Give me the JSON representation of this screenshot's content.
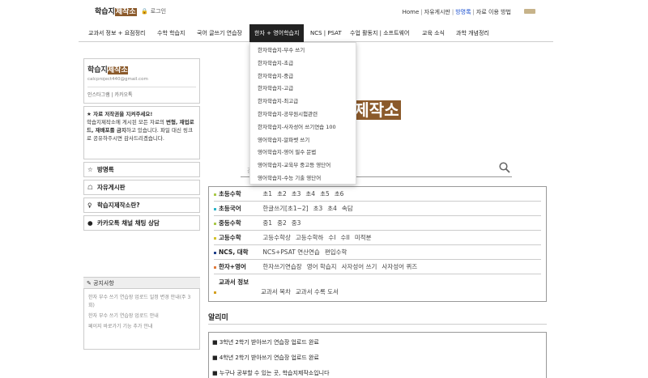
{
  "header": {
    "logo_text": "학습지",
    "logo_highlight": "제작소",
    "login_label": "로그인",
    "links": [
      "Home",
      "자유게시판",
      "방명록",
      "자료 이용 방법"
    ]
  },
  "nav": {
    "items": [
      "교과서 정보 + 요점정리",
      "수학 학습지",
      "국어 글쓰기 연습장",
      "한자 + 영어학습지",
      "NCS | PSAT",
      "수업 활동지 | 소프트웨어",
      "교육 소식",
      "과학 개념정리"
    ],
    "active": "한자 + 영어학습지"
  },
  "dropdown": {
    "items": [
      "한자학습지-부수 쓰기",
      "한자학습지-초급",
      "한자학습지-중급",
      "한자학습지-고급",
      "한자학습지-최고급",
      "한자학습지-공무원시험관련",
      "한자학습지-사자성어 쓰기연습 100",
      "영어학습지-알파벳 쓰기",
      "영어학습지-영어 필수 문법",
      "영어학습지-교육부 중고등 영단어",
      "영어학습지-수능 기출 영단어"
    ]
  },
  "profile": {
    "name_a": "학습지",
    "name_b": "제작소",
    "email": "calcproject440@gmail.com",
    "links": "인스타그램 | 카카오톡"
  },
  "notice": {
    "title": "★ 자료 저작권을 지켜주세요!",
    "body1": "학습지제작소에 게시된 모든 자료의 ",
    "bold1": "변형, 재업로드, 재배포를 금지",
    "body2": "하고 있습니다. 파일 대신 링크로 공유하주시면 감사드리겠습니다."
  },
  "side_items": [
    {
      "icon": "☆",
      "label": "방명록"
    },
    {
      "icon": "☖",
      "label": "자유게시판"
    },
    {
      "icon": "♀",
      "label": "학습지제작소란?"
    },
    {
      "icon": "●",
      "label": "카카오톡 채널 채팅 상담"
    }
  ],
  "announce": {
    "title": "공지사항",
    "items": [
      "한자 부수 쓰기 연습장 업로드 일정 변경 안내(주 3회)",
      "한자 부수 쓰기 연습장 업로드 안내",
      "페이지 바로가기 기능 추가 안내"
    ]
  },
  "main": {
    "logo_text": "지",
    "logo_highlight": "제작소",
    "search_hint": "검"
  },
  "categories": [
    {
      "name": "초등수학",
      "color": "#a9c94a",
      "links": [
        "초1",
        "초2",
        "초3",
        "초4",
        "초5",
        "초6"
      ]
    },
    {
      "name": "초등국어",
      "color": "#2ab3c8",
      "links": [
        "한글쓰기[초1~2]",
        "초3",
        "초4",
        "속담"
      ]
    },
    {
      "name": "중등수학",
      "color": "#a9c94a",
      "links": [
        "중1",
        "중2",
        "중3"
      ]
    },
    {
      "name": "고등수학",
      "color": "#d4c22a",
      "links": [
        "고등수학상",
        "고등수학하",
        "수I",
        "수II",
        "미적분"
      ]
    },
    {
      "name": "NCS, 대학",
      "color": "#1f3f8a",
      "links": [
        "NCS+PSAT 연산연습",
        "편입수학"
      ]
    },
    {
      "name": "한자+영어",
      "color": "#e07a3a",
      "links": [
        "한자쓰기연습장",
        "영어 학습지",
        "사자성어 쓰기",
        "사자성어 퀴즈"
      ]
    },
    {
      "name": "교과서 정보",
      "color": "#d4a020",
      "links": [
        "교과서 목차",
        "교과서 수록 도서"
      ]
    }
  ],
  "alimi": {
    "title": "알리미",
    "items": [
      "3학년 2학기 받아쓰기 연습장 업로드 완료",
      "4학년 2학기 받아쓰기 연습장 업로드 완료",
      "누구나 공부할 수 있는 곳, 학습지제작소입니다"
    ]
  }
}
